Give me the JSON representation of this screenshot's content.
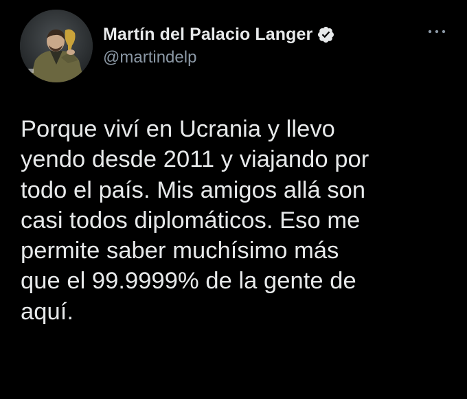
{
  "tweet": {
    "author": {
      "display_name": "Martín del Palacio Langer",
      "handle": "@martindelp",
      "verified": true,
      "avatar_icon": "profile-photo"
    },
    "more_icon": "more-options-icon",
    "text": "Porque viví en Ucrania y llevo\nyendo desde 2011 y viajando por\ntodo el país. Mis amigos allá son\ncasi todos diplomáticos. Eso me\npermite saber muchísimo más\nque el 99.9999% de la gente de\naquí."
  },
  "colors": {
    "background": "#000000",
    "text_primary": "#e7e9ea",
    "text_secondary": "#8b98a5",
    "verified_badge": "#e7e9ea"
  }
}
